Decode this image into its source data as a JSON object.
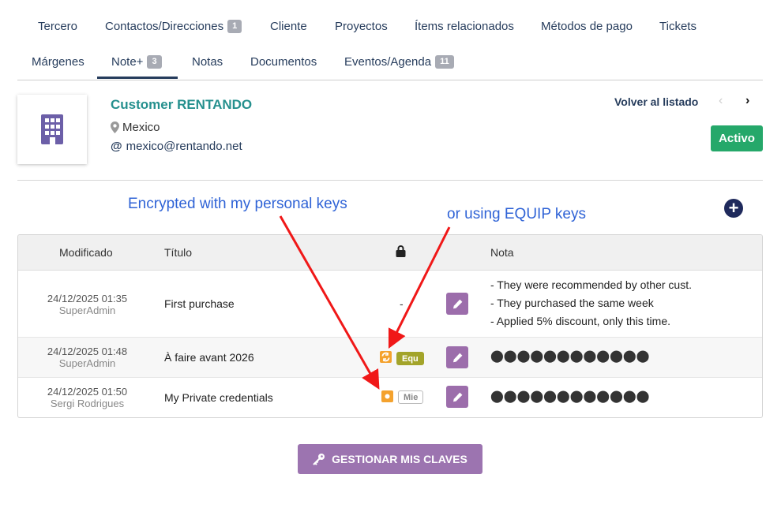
{
  "tabs": {
    "row1": [
      {
        "label": "Tercero"
      },
      {
        "label": "Contactos/Direcciones",
        "badge": "1"
      },
      {
        "label": "Cliente"
      },
      {
        "label": "Proyectos"
      },
      {
        "label": "Ítems relacionados"
      },
      {
        "label": "Métodos de pago"
      },
      {
        "label": "Tickets"
      }
    ],
    "row2": [
      {
        "label": "Márgenes"
      },
      {
        "label": "Note+",
        "badge": "3",
        "active": true
      },
      {
        "label": "Notas"
      },
      {
        "label": "Documentos"
      },
      {
        "label": "Eventos/Agenda",
        "badge": "11"
      }
    ]
  },
  "company": {
    "name": "Customer RENTANDO",
    "country": "Mexico",
    "email": "mexico@rentando.net",
    "logo_icon": "building-icon"
  },
  "nav": {
    "back_label": "Volver al listado",
    "prev_icon": "chevron-left-icon",
    "next_icon": "chevron-right-icon",
    "prev_glyph": "‹",
    "next_glyph": "›"
  },
  "status": {
    "label": "Activo",
    "color": "#25a86a"
  },
  "annotations": {
    "personal": "Encrypted with my personal keys",
    "equip": "or using EQUIP keys"
  },
  "table": {
    "headers": {
      "modified": "Modificado",
      "title": "Título",
      "lock_icon": "lock-icon",
      "note": "Nota"
    },
    "rows": [
      {
        "date": "24/12/2025 01:35",
        "user": "SuperAdmin",
        "title": "First purchase",
        "encryption": "-",
        "note_lines": [
          "- They were recommended by other cust.",
          "- They purchased the same week",
          "- Applied 5% discount, only this time."
        ]
      },
      {
        "date": "24/12/2025 01:48",
        "user": "SuperAdmin",
        "title": "À faire avant 2026",
        "encryption_tag": "Equ",
        "note_hidden": "⬤⬤⬤⬤⬤⬤⬤⬤⬤⬤⬤⬤"
      },
      {
        "date": "24/12/2025 01:50",
        "user": "Sergi Rodrigues",
        "title": "My Private credentials",
        "encryption_tag": "Mie",
        "note_hidden": "⬤⬤⬤⬤⬤⬤⬤⬤⬤⬤⬤⬤"
      }
    ]
  },
  "manage_keys": {
    "label": "GESTIONAR MIS CLAVES",
    "icon": "key-icon"
  },
  "add_icon": "plus-circle-icon",
  "colors": {
    "accent": "#263c5c",
    "company": "#25908e",
    "button": "#9c74b0",
    "annotation": "#2f63d6",
    "arrow": "#f01818"
  }
}
